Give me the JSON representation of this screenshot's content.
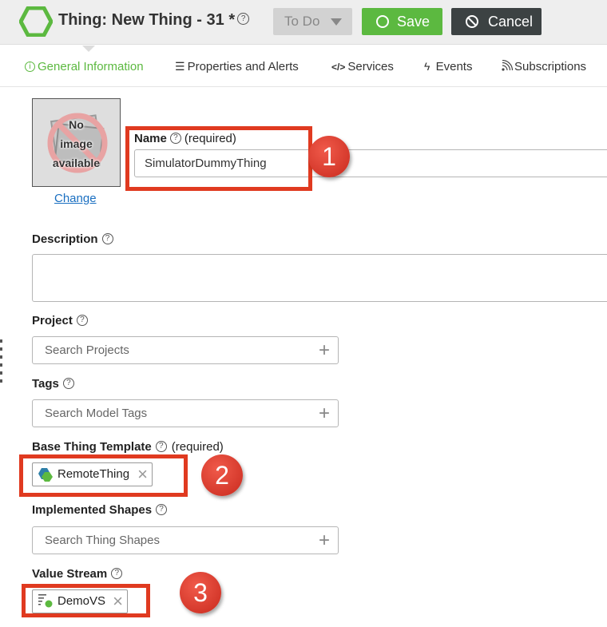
{
  "header": {
    "title": "Thing: New Thing - 31 *",
    "state_label": "To Do",
    "save_label": "Save",
    "cancel_label": "Cancel"
  },
  "tabs": [
    {
      "label": "General Information",
      "icon": "info-circle-icon",
      "active": true
    },
    {
      "label": "Properties and Alerts",
      "icon": "list-icon",
      "active": false
    },
    {
      "label": "Services",
      "icon": "code-icon",
      "active": false
    },
    {
      "label": "Events",
      "icon": "lightning-icon",
      "active": false
    },
    {
      "label": "Subscriptions",
      "icon": "feed-icon",
      "active": false
    }
  ],
  "image": {
    "placeholder_lines": [
      "No",
      "image",
      "available"
    ],
    "change_label": "Change"
  },
  "fields": {
    "name": {
      "label": "Name",
      "required_text": "(required)",
      "value": "SimulatorDummyThing"
    },
    "description": {
      "label": "Description",
      "value": ""
    },
    "project": {
      "label": "Project",
      "placeholder": "Search Projects"
    },
    "tags": {
      "label": "Tags",
      "placeholder": "Search Model Tags"
    },
    "base_template": {
      "label": "Base Thing Template",
      "required_text": "(required)",
      "value": "RemoteThing"
    },
    "shapes": {
      "label": "Implemented Shapes",
      "placeholder": "Search Thing Shapes"
    },
    "value_stream": {
      "label": "Value Stream",
      "value": "DemoVS"
    }
  },
  "callouts": [
    "1",
    "2",
    "3"
  ],
  "colors": {
    "accent_green": "#5cb940",
    "callout_red": "#e03a20",
    "cancel_dark": "#3c4243",
    "link_blue": "#1a6fc1"
  }
}
